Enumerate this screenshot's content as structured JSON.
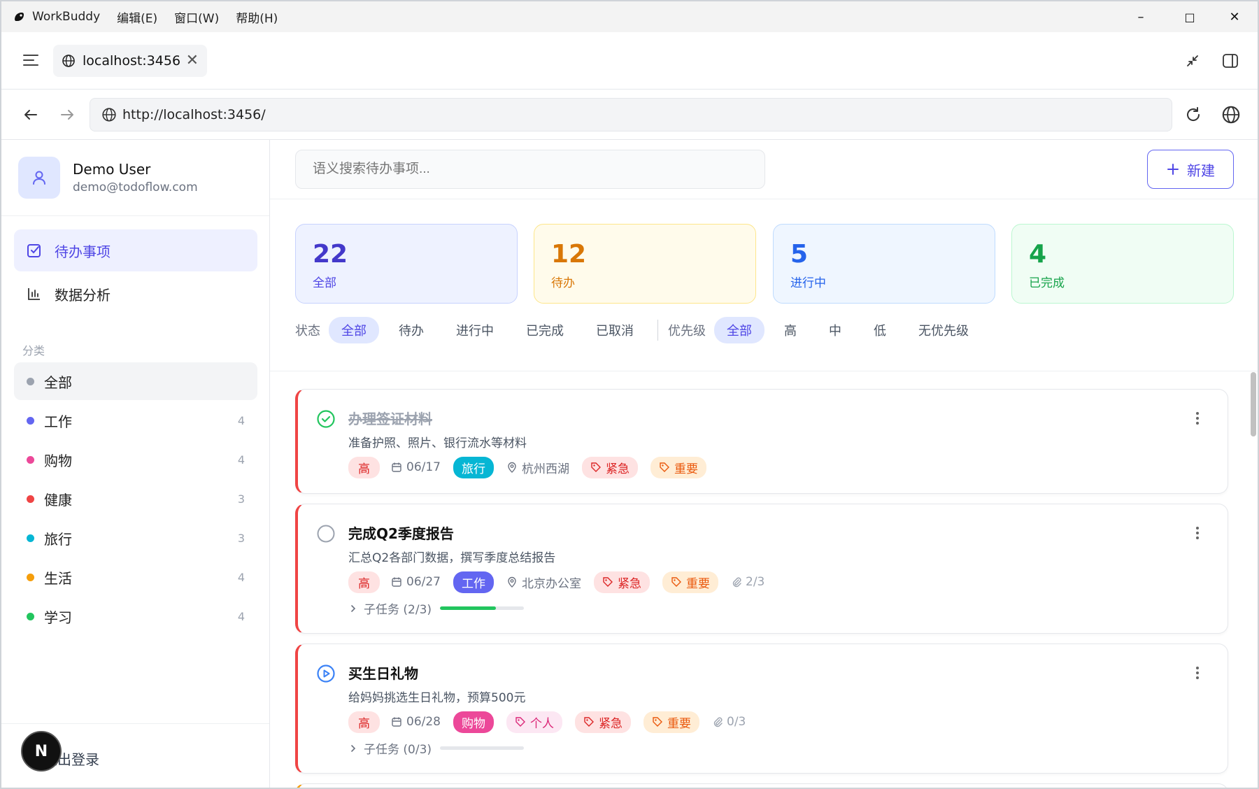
{
  "app": {
    "name": "WorkBuddy",
    "menus": [
      "编辑(E)",
      "窗口(W)",
      "帮助(H)"
    ]
  },
  "window_controls": {
    "minimize": "–",
    "maximize": "□",
    "close": "✕"
  },
  "tab": {
    "title": "localhost:3456",
    "close": "✕"
  },
  "address": {
    "url": "http://localhost:3456/"
  },
  "user": {
    "name": "Demo User",
    "email": "demo@todoflow.com"
  },
  "nav": [
    {
      "label": "待办事项",
      "active": true
    },
    {
      "label": "数据分析",
      "active": false
    }
  ],
  "categories": {
    "heading": "分类",
    "items": [
      {
        "label": "全部",
        "count": "",
        "color": "#9ca3af",
        "active": true
      },
      {
        "label": "工作",
        "count": "4",
        "color": "#6366f1"
      },
      {
        "label": "购物",
        "count": "4",
        "color": "#ec4899"
      },
      {
        "label": "健康",
        "count": "3",
        "color": "#ef4444"
      },
      {
        "label": "旅行",
        "count": "3",
        "color": "#06b6d4"
      },
      {
        "label": "生活",
        "count": "4",
        "color": "#f59e0b"
      },
      {
        "label": "学习",
        "count": "4",
        "color": "#22c55e"
      }
    ]
  },
  "logout": "退出登录",
  "n_badge": "N",
  "search": {
    "placeholder": "语义搜索待办事项..."
  },
  "new_button": "新建",
  "stats": [
    {
      "value": "22",
      "label": "全部",
      "color": "#4338ca",
      "bg": "#eef2ff",
      "border": "#c7d2fe"
    },
    {
      "value": "12",
      "label": "待办",
      "color": "#d97706",
      "bg": "#fffbeb",
      "border": "#fde68a"
    },
    {
      "value": "5",
      "label": "进行中",
      "color": "#2563eb",
      "bg": "#eff6ff",
      "border": "#bfdbfe"
    },
    {
      "value": "4",
      "label": "已完成",
      "color": "#16a34a",
      "bg": "#f0fdf4",
      "border": "#bbf7d0"
    }
  ],
  "filters": {
    "status_label": "状态",
    "status": [
      "全部",
      "待办",
      "进行中",
      "已完成",
      "已取消"
    ],
    "priority_label": "优先级",
    "priority": [
      "全部",
      "高",
      "中",
      "低",
      "无优先级"
    ]
  },
  "todos": [
    {
      "title": "办理签证材料",
      "desc": "准备护照、照片、银行流水等材料",
      "priority": "高",
      "date": "06/17",
      "category": "旅行",
      "category_color": "#06b6d4",
      "location": "杭州西湖",
      "tags": [
        {
          "label": "紧急",
          "style": "red"
        },
        {
          "label": "重要",
          "style": "orange"
        }
      ],
      "attachments": "",
      "subtasks": "",
      "progress": null,
      "status": "done"
    },
    {
      "title": "完成Q2季度报告",
      "desc": "汇总Q2各部门数据，撰写季度总结报告",
      "priority": "高",
      "date": "06/27",
      "category": "工作",
      "category_color": "#6366f1",
      "location": "北京办公室",
      "tags": [
        {
          "label": "紧急",
          "style": "red"
        },
        {
          "label": "重要",
          "style": "orange"
        }
      ],
      "attachments": "2/3",
      "subtasks": "子任务 (2/3)",
      "progress": 0.67,
      "status": "todo"
    },
    {
      "title": "买生日礼物",
      "desc": "给妈妈挑选生日礼物，预算500元",
      "priority": "高",
      "date": "06/28",
      "category": "购物",
      "category_color": "#ec4899",
      "location": "",
      "tags": [
        {
          "label": "个人",
          "style": "pink"
        },
        {
          "label": "紧急",
          "style": "red"
        },
        {
          "label": "重要",
          "style": "orange"
        }
      ],
      "attachments": "0/3",
      "subtasks": "子任务 (0/3)",
      "progress": 0,
      "status": "in_progress"
    }
  ]
}
